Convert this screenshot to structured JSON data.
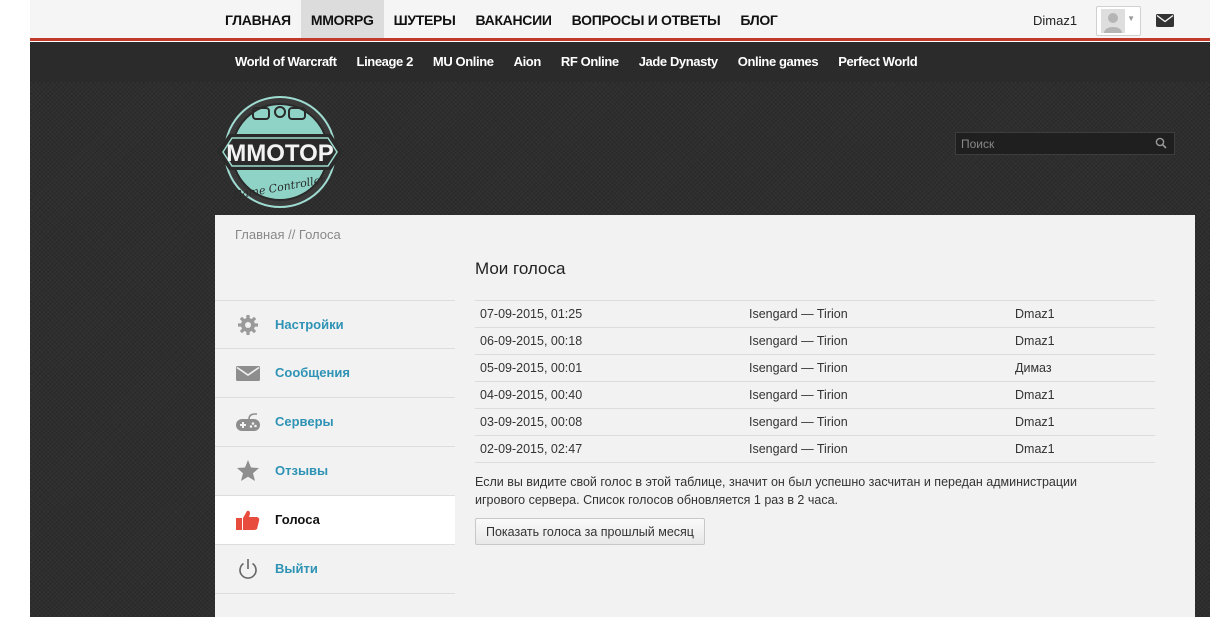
{
  "topnav": {
    "items": [
      {
        "label": "ГЛАВНАЯ"
      },
      {
        "label": "MMORPG"
      },
      {
        "label": "ШУТЕРЫ"
      },
      {
        "label": "ВАКАНСИИ"
      },
      {
        "label": "ВОПРОСЫ И ОТВЕТЫ"
      },
      {
        "label": "БЛОГ"
      }
    ],
    "user_name": "Dimaz1"
  },
  "subnav": {
    "items": [
      {
        "label": "World of Warcraft"
      },
      {
        "label": "Lineage 2"
      },
      {
        "label": "MU Online"
      },
      {
        "label": "Aion"
      },
      {
        "label": "RF Online"
      },
      {
        "label": "Jade Dynasty"
      },
      {
        "label": "Online games"
      },
      {
        "label": "Perfect World"
      }
    ]
  },
  "logo": {
    "text": "MMOTOP",
    "subtitle": "Game Controller"
  },
  "search": {
    "placeholder": "Поиск"
  },
  "breadcrumb": "Главная // Голоса",
  "page_title": "Мои голоса",
  "sidebar": {
    "items": [
      {
        "label": "Настройки",
        "icon": "gear-icon"
      },
      {
        "label": "Сообщения",
        "icon": "envelope-icon"
      },
      {
        "label": "Серверы",
        "icon": "gamepad-icon"
      },
      {
        "label": "Отзывы",
        "icon": "star-icon"
      },
      {
        "label": "Голоса",
        "icon": "thumbs-up-icon"
      },
      {
        "label": "Выйти",
        "icon": "power-icon"
      }
    ]
  },
  "votes": {
    "rows": [
      {
        "date": "07-09-2015, 01:25",
        "server": "Isengard — Tirion",
        "nick": "Dmaz1"
      },
      {
        "date": "06-09-2015, 00:18",
        "server": "Isengard — Tirion",
        "nick": "Dmaz1"
      },
      {
        "date": "05-09-2015, 00:01",
        "server": "Isengard — Tirion",
        "nick": "Димаз"
      },
      {
        "date": "04-09-2015, 00:40",
        "server": "Isengard — Tirion",
        "nick": "Dmaz1"
      },
      {
        "date": "03-09-2015, 00:08",
        "server": "Isengard — Tirion",
        "nick": "Dmaz1"
      },
      {
        "date": "02-09-2015, 02:47",
        "server": "Isengard — Tirion",
        "nick": "Dmaz1"
      }
    ]
  },
  "note": "Если вы видите свой голос в этой таблице, значит он был успешно засчитан и передан администрации игрового сервера. Список голосов обновляется 1 раз в 2 часа.",
  "show_last_month_button": "Показать голоса за прошлый месяц",
  "colors": {
    "accent": "#c0392b",
    "link": "#2e93b5",
    "thumbs": "#e74c3c",
    "logo_teal": "#8fd3c7"
  }
}
